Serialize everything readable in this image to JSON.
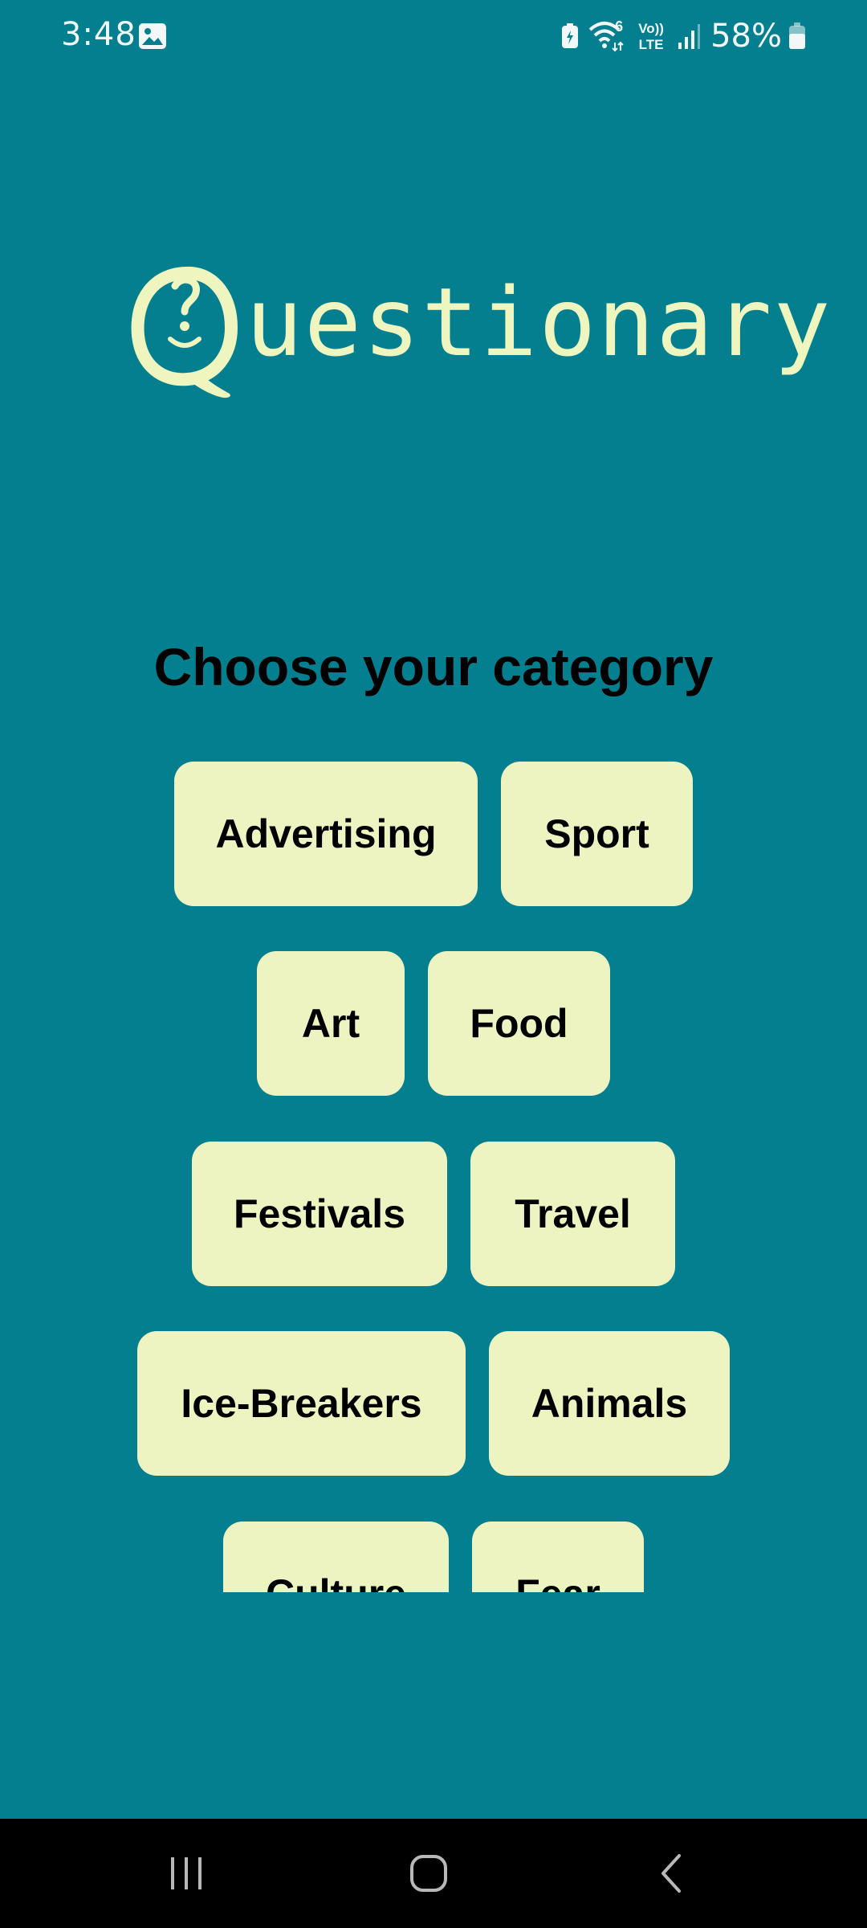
{
  "status_bar": {
    "time": "3:48",
    "battery_percent": "58%",
    "icons": [
      "gallery-icon",
      "battery-saver-icon",
      "wifi-icon",
      "volte-icon",
      "signal-icon",
      "battery-icon"
    ],
    "wifi_label": "6",
    "volte_label_top": "Vo))",
    "volte_label_bottom": "LTE"
  },
  "app": {
    "logo_rest": "uestionary",
    "logo_q_icon": "q-face-logo-icon",
    "heading": "Choose your category",
    "categories": [
      "Advertising",
      "Sport",
      "Art",
      "Food",
      "Festivals",
      "Travel",
      "Ice-Breakers",
      "Animals",
      "Culture",
      "Fear"
    ]
  },
  "nav_bar": {
    "icons": [
      "recents-icon",
      "home-icon",
      "back-icon"
    ]
  },
  "colors": {
    "background": "#037f8f",
    "button": "#eef4c1",
    "logo": "#eef5bf",
    "text": "#000000",
    "nav_bar": "#000000"
  }
}
